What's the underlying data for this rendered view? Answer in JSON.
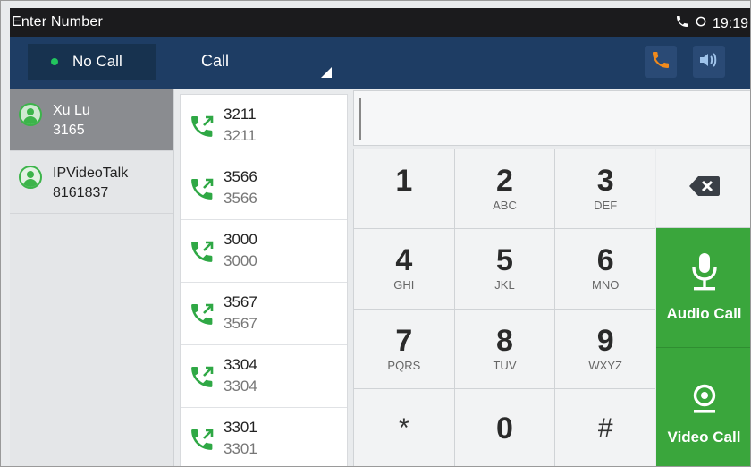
{
  "status": {
    "title": "Enter Number",
    "time": "19:19"
  },
  "topbar": {
    "no_call": "No Call",
    "call_select": "Call"
  },
  "contacts": [
    {
      "name": "Xu Lu",
      "number": "3165"
    },
    {
      "name": "IPVideoTalk",
      "number": "8161837"
    }
  ],
  "history": [
    {
      "name": "3211",
      "number": "3211"
    },
    {
      "name": "3566",
      "number": "3566"
    },
    {
      "name": "3000",
      "number": "3000"
    },
    {
      "name": "3567",
      "number": "3567"
    },
    {
      "name": "3304",
      "number": "3304"
    },
    {
      "name": "3301",
      "number": "3301"
    }
  ],
  "dial_input": {
    "value": "",
    "placeholder": ""
  },
  "keypad": [
    {
      "digit": "1",
      "letters": ""
    },
    {
      "digit": "2",
      "letters": "ABC"
    },
    {
      "digit": "3",
      "letters": "DEF"
    },
    {
      "digit": "4",
      "letters": "GHI"
    },
    {
      "digit": "5",
      "letters": "JKL"
    },
    {
      "digit": "6",
      "letters": "MNO"
    },
    {
      "digit": "7",
      "letters": "PQRS"
    },
    {
      "digit": "8",
      "letters": "TUV"
    },
    {
      "digit": "9",
      "letters": "WXYZ"
    },
    {
      "digit": "*",
      "letters": ""
    },
    {
      "digit": "0",
      "letters": ""
    },
    {
      "digit": "#",
      "letters": ""
    }
  ],
  "actions": {
    "audio_call": "Audio Call",
    "video_call": "Video Call"
  },
  "colors": {
    "topbar": "#1e3d64",
    "status_bar": "#1b1b1d",
    "call_green": "#3aa63c",
    "phone_orange": "#f08a1c",
    "active_contact": "#8a8c90"
  },
  "icons": {
    "status": [
      "phone-icon",
      "sync-icon"
    ],
    "topbar": [
      "phone-icon",
      "speaker-icon"
    ],
    "contact": "person-avatar-icon",
    "history": "outgoing-call-icon",
    "backspace": "backspace-icon",
    "audio": "microphone-icon",
    "video": "webcam-icon"
  }
}
